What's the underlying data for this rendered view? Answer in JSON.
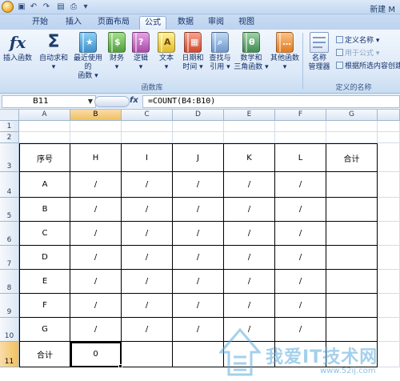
{
  "window": {
    "title": "新建 M"
  },
  "tabs": [
    "开始",
    "插入",
    "页面布局",
    "公式",
    "数据",
    "审阅",
    "视图"
  ],
  "active_tab": "公式",
  "ribbon": {
    "buttons": [
      {
        "label1": "插入函数",
        "label2": "",
        "icon": "fx-icon"
      },
      {
        "label1": "自动求和",
        "label2": "▾",
        "icon": "sigma-icon"
      },
      {
        "label1": "最近使用的",
        "label2": "函数 ▾",
        "icon": "book-star-icon"
      },
      {
        "label1": "财务",
        "label2": "▾",
        "icon": "book-money-icon"
      },
      {
        "label1": "逻辑",
        "label2": "▾",
        "icon": "book-question-icon"
      },
      {
        "label1": "文本",
        "label2": "▾",
        "icon": "book-text-icon"
      },
      {
        "label1": "日期和",
        "label2": "时间 ▾",
        "icon": "book-calendar-icon"
      },
      {
        "label1": "查找与",
        "label2": "引用 ▾",
        "icon": "book-search-icon"
      },
      {
        "label1": "数学和",
        "label2": "三角函数 ▾",
        "icon": "book-theta-icon"
      },
      {
        "label1": "其他函数",
        "label2": "▾",
        "icon": "book-more-icon"
      },
      {
        "label1": "名称",
        "label2": "管理器",
        "icon": "name-manager-icon"
      }
    ],
    "group_function_library": "函数库",
    "group_defined_names": "定义的名称",
    "define_name": "定义名称 ▾",
    "use_in_formula": "用于公式 ▾",
    "create_from_selection": "根据所选内容创建"
  },
  "formula_bar": {
    "name_box": "B11",
    "fx": "fx",
    "formula": "=COUNT(B4:B10)"
  },
  "grid": {
    "columns": [
      "A",
      "B",
      "C",
      "D",
      "E",
      "F",
      "G"
    ],
    "rows": [
      "1",
      "2",
      "3",
      "4",
      "5",
      "6",
      "7",
      "8",
      "9",
      "10",
      "11"
    ],
    "selected_cell": "B11",
    "table": [
      [
        "序号",
        "H",
        "I",
        "J",
        "K",
        "L",
        "合计"
      ],
      [
        "A",
        "/",
        "/",
        "/",
        "/",
        "/",
        ""
      ],
      [
        "B",
        "/",
        "/",
        "/",
        "/",
        "/",
        ""
      ],
      [
        "C",
        "/",
        "/",
        "/",
        "/",
        "/",
        ""
      ],
      [
        "D",
        "/",
        "/",
        "/",
        "/",
        "/",
        ""
      ],
      [
        "E",
        "/",
        "/",
        "/",
        "/",
        "/",
        ""
      ],
      [
        "F",
        "/",
        "/",
        "/",
        "/",
        "/",
        ""
      ],
      [
        "G",
        "/",
        "/",
        "/",
        "/",
        "/",
        ""
      ],
      [
        "合计",
        "0",
        "",
        "",
        "",
        "",
        ""
      ]
    ]
  },
  "watermark": {
    "text": "我爱IT技术网",
    "url": "www.52ij.com"
  },
  "colors": {
    "accent_selected_header": "#f1c15e",
    "ribbon_bg": "#dbe8f7",
    "grid_line": "#d4dce8"
  }
}
